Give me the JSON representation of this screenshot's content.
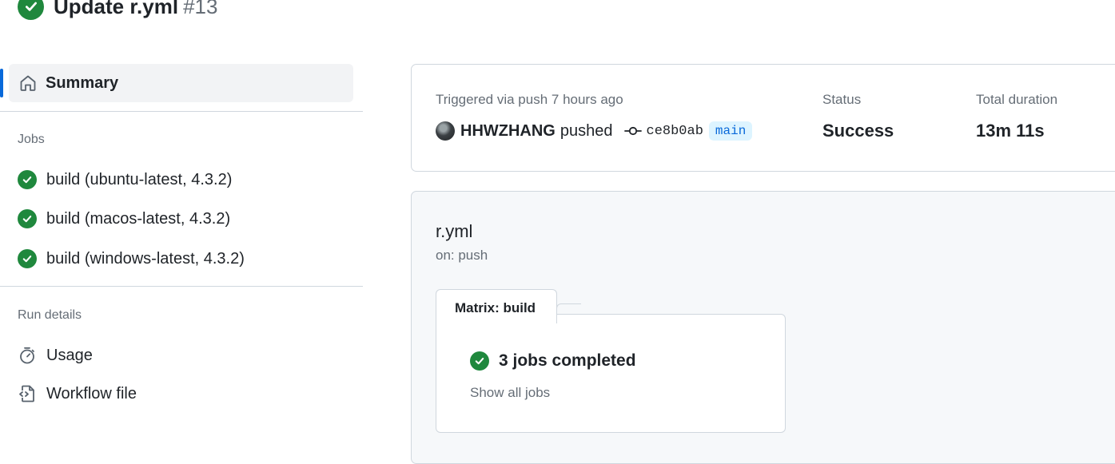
{
  "header": {
    "title": "Update r.yml",
    "run_number": "#13",
    "status_color": "#1f883d"
  },
  "sidebar": {
    "summary_label": "Summary",
    "jobs_heading": "Jobs",
    "jobs": [
      {
        "label": "build (ubuntu-latest, 4.3.2)",
        "status": "success"
      },
      {
        "label": "build (macos-latest, 4.3.2)",
        "status": "success"
      },
      {
        "label": "build (windows-latest, 4.3.2)",
        "status": "success"
      }
    ],
    "run_details_heading": "Run details",
    "details": [
      {
        "label": "Usage",
        "icon": "stopwatch-icon"
      },
      {
        "label": "Workflow file",
        "icon": "file-code-icon"
      }
    ],
    "active_color": "#0969da"
  },
  "summary_card": {
    "trigger_text": "Triggered via push 7 hours ago",
    "actor": "HHWZHANG",
    "action": "pushed",
    "commit": "ce8b0ab",
    "branch": "main",
    "status_label": "Status",
    "status_value": "Success",
    "duration_label": "Total duration",
    "duration_value": "13m 11s"
  },
  "workflow": {
    "name": "r.yml",
    "trigger": "on: push",
    "matrix_label": "Matrix: build",
    "jobs_completed": "3 jobs completed",
    "show_all": "Show all jobs"
  }
}
